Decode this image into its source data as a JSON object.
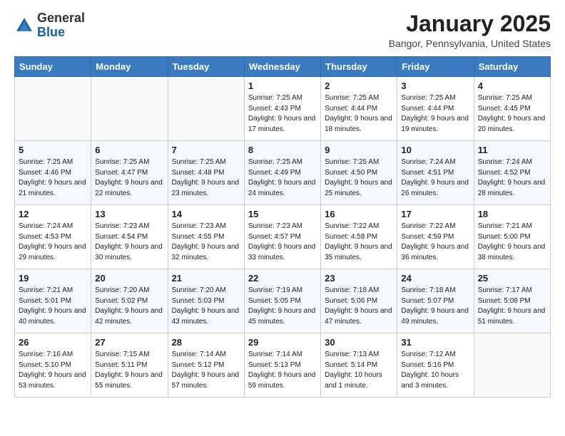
{
  "header": {
    "logo_general": "General",
    "logo_blue": "Blue",
    "month_title": "January 2025",
    "location": "Bangor, Pennsylvania, United States"
  },
  "weekdays": [
    "Sunday",
    "Monday",
    "Tuesday",
    "Wednesday",
    "Thursday",
    "Friday",
    "Saturday"
  ],
  "weeks": [
    [
      {
        "day": "",
        "sunrise": "",
        "sunset": "",
        "daylight": ""
      },
      {
        "day": "",
        "sunrise": "",
        "sunset": "",
        "daylight": ""
      },
      {
        "day": "",
        "sunrise": "",
        "sunset": "",
        "daylight": ""
      },
      {
        "day": "1",
        "sunrise": "Sunrise: 7:25 AM",
        "sunset": "Sunset: 4:43 PM",
        "daylight": "Daylight: 9 hours and 17 minutes."
      },
      {
        "day": "2",
        "sunrise": "Sunrise: 7:25 AM",
        "sunset": "Sunset: 4:44 PM",
        "daylight": "Daylight: 9 hours and 18 minutes."
      },
      {
        "day": "3",
        "sunrise": "Sunrise: 7:25 AM",
        "sunset": "Sunset: 4:44 PM",
        "daylight": "Daylight: 9 hours and 19 minutes."
      },
      {
        "day": "4",
        "sunrise": "Sunrise: 7:25 AM",
        "sunset": "Sunset: 4:45 PM",
        "daylight": "Daylight: 9 hours and 20 minutes."
      }
    ],
    [
      {
        "day": "5",
        "sunrise": "Sunrise: 7:25 AM",
        "sunset": "Sunset: 4:46 PM",
        "daylight": "Daylight: 9 hours and 21 minutes."
      },
      {
        "day": "6",
        "sunrise": "Sunrise: 7:25 AM",
        "sunset": "Sunset: 4:47 PM",
        "daylight": "Daylight: 9 hours and 22 minutes."
      },
      {
        "day": "7",
        "sunrise": "Sunrise: 7:25 AM",
        "sunset": "Sunset: 4:48 PM",
        "daylight": "Daylight: 9 hours and 23 minutes."
      },
      {
        "day": "8",
        "sunrise": "Sunrise: 7:25 AM",
        "sunset": "Sunset: 4:49 PM",
        "daylight": "Daylight: 9 hours and 24 minutes."
      },
      {
        "day": "9",
        "sunrise": "Sunrise: 7:25 AM",
        "sunset": "Sunset: 4:50 PM",
        "daylight": "Daylight: 9 hours and 25 minutes."
      },
      {
        "day": "10",
        "sunrise": "Sunrise: 7:24 AM",
        "sunset": "Sunset: 4:51 PM",
        "daylight": "Daylight: 9 hours and 26 minutes."
      },
      {
        "day": "11",
        "sunrise": "Sunrise: 7:24 AM",
        "sunset": "Sunset: 4:52 PM",
        "daylight": "Daylight: 9 hours and 28 minutes."
      }
    ],
    [
      {
        "day": "12",
        "sunrise": "Sunrise: 7:24 AM",
        "sunset": "Sunset: 4:53 PM",
        "daylight": "Daylight: 9 hours and 29 minutes."
      },
      {
        "day": "13",
        "sunrise": "Sunrise: 7:23 AM",
        "sunset": "Sunset: 4:54 PM",
        "daylight": "Daylight: 9 hours and 30 minutes."
      },
      {
        "day": "14",
        "sunrise": "Sunrise: 7:23 AM",
        "sunset": "Sunset: 4:55 PM",
        "daylight": "Daylight: 9 hours and 32 minutes."
      },
      {
        "day": "15",
        "sunrise": "Sunrise: 7:23 AM",
        "sunset": "Sunset: 4:57 PM",
        "daylight": "Daylight: 9 hours and 33 minutes."
      },
      {
        "day": "16",
        "sunrise": "Sunrise: 7:22 AM",
        "sunset": "Sunset: 4:58 PM",
        "daylight": "Daylight: 9 hours and 35 minutes."
      },
      {
        "day": "17",
        "sunrise": "Sunrise: 7:22 AM",
        "sunset": "Sunset: 4:59 PM",
        "daylight": "Daylight: 9 hours and 36 minutes."
      },
      {
        "day": "18",
        "sunrise": "Sunrise: 7:21 AM",
        "sunset": "Sunset: 5:00 PM",
        "daylight": "Daylight: 9 hours and 38 minutes."
      }
    ],
    [
      {
        "day": "19",
        "sunrise": "Sunrise: 7:21 AM",
        "sunset": "Sunset: 5:01 PM",
        "daylight": "Daylight: 9 hours and 40 minutes."
      },
      {
        "day": "20",
        "sunrise": "Sunrise: 7:20 AM",
        "sunset": "Sunset: 5:02 PM",
        "daylight": "Daylight: 9 hours and 42 minutes."
      },
      {
        "day": "21",
        "sunrise": "Sunrise: 7:20 AM",
        "sunset": "Sunset: 5:03 PM",
        "daylight": "Daylight: 9 hours and 43 minutes."
      },
      {
        "day": "22",
        "sunrise": "Sunrise: 7:19 AM",
        "sunset": "Sunset: 5:05 PM",
        "daylight": "Daylight: 9 hours and 45 minutes."
      },
      {
        "day": "23",
        "sunrise": "Sunrise: 7:18 AM",
        "sunset": "Sunset: 5:06 PM",
        "daylight": "Daylight: 9 hours and 47 minutes."
      },
      {
        "day": "24",
        "sunrise": "Sunrise: 7:18 AM",
        "sunset": "Sunset: 5:07 PM",
        "daylight": "Daylight: 9 hours and 49 minutes."
      },
      {
        "day": "25",
        "sunrise": "Sunrise: 7:17 AM",
        "sunset": "Sunset: 5:08 PM",
        "daylight": "Daylight: 9 hours and 51 minutes."
      }
    ],
    [
      {
        "day": "26",
        "sunrise": "Sunrise: 7:16 AM",
        "sunset": "Sunset: 5:10 PM",
        "daylight": "Daylight: 9 hours and 53 minutes."
      },
      {
        "day": "27",
        "sunrise": "Sunrise: 7:15 AM",
        "sunset": "Sunset: 5:11 PM",
        "daylight": "Daylight: 9 hours and 55 minutes."
      },
      {
        "day": "28",
        "sunrise": "Sunrise: 7:14 AM",
        "sunset": "Sunset: 5:12 PM",
        "daylight": "Daylight: 9 hours and 57 minutes."
      },
      {
        "day": "29",
        "sunrise": "Sunrise: 7:14 AM",
        "sunset": "Sunset: 5:13 PM",
        "daylight": "Daylight: 9 hours and 59 minutes."
      },
      {
        "day": "30",
        "sunrise": "Sunrise: 7:13 AM",
        "sunset": "Sunset: 5:14 PM",
        "daylight": "Daylight: 10 hours and 1 minute."
      },
      {
        "day": "31",
        "sunrise": "Sunrise: 7:12 AM",
        "sunset": "Sunset: 5:16 PM",
        "daylight": "Daylight: 10 hours and 3 minutes."
      },
      {
        "day": "",
        "sunrise": "",
        "sunset": "",
        "daylight": ""
      }
    ]
  ]
}
